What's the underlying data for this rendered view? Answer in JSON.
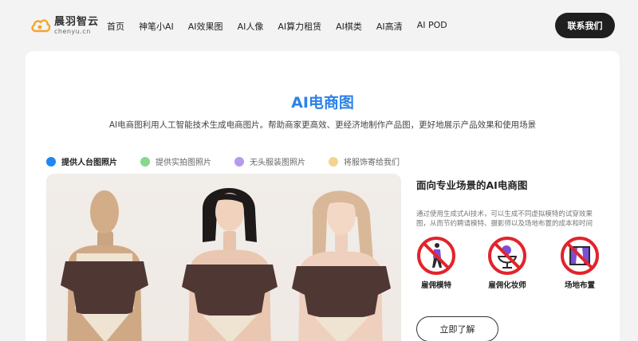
{
  "brand": {
    "name_cn": "晨羽智云",
    "name_en": "chenyu.cn"
  },
  "nav": {
    "items": [
      "首页",
      "神笔小AI",
      "AI效果图",
      "AI人像",
      "AI算力租赁",
      "AI棋类",
      "AI高清",
      "AI POD"
    ]
  },
  "header": {
    "contact_label": "联系我们"
  },
  "main": {
    "title": "AI电商图",
    "subtitle": "AI电商图利用人工智能技术生成电商图片。帮助商家更高效、更经济地制作产品图，更好地展示产品效果和使用场景",
    "tabs": [
      {
        "label": "提供人台图照片",
        "color": "#1e87f0",
        "active": true
      },
      {
        "label": "提供实拍图照片",
        "color": "#86d98a",
        "active": false
      },
      {
        "label": "无头服装图照片",
        "color": "#b79af0",
        "active": false
      },
      {
        "label": "将服饰寄给我们",
        "color": "#f5d38e",
        "active": false
      }
    ],
    "side": {
      "title": "面向专业场景的AI电商图",
      "description": "通过使用生成式AI技术，可以生成不同虚拟模特的试穿效果图，从而节约聘请模特、摄影师以及场地布置的成本和时间",
      "features": [
        {
          "label": "雇佣模特",
          "icon": "no-model-icon"
        },
        {
          "label": "雇佣化妆师",
          "icon": "no-makeup-artist-icon"
        },
        {
          "label": "场地布置",
          "icon": "no-venue-icon"
        }
      ],
      "cta_label": "立即了解"
    }
  },
  "colors": {
    "accent": "#2b82e8",
    "prohibit": "#e3232b",
    "dark": "#1f1f1f"
  }
}
